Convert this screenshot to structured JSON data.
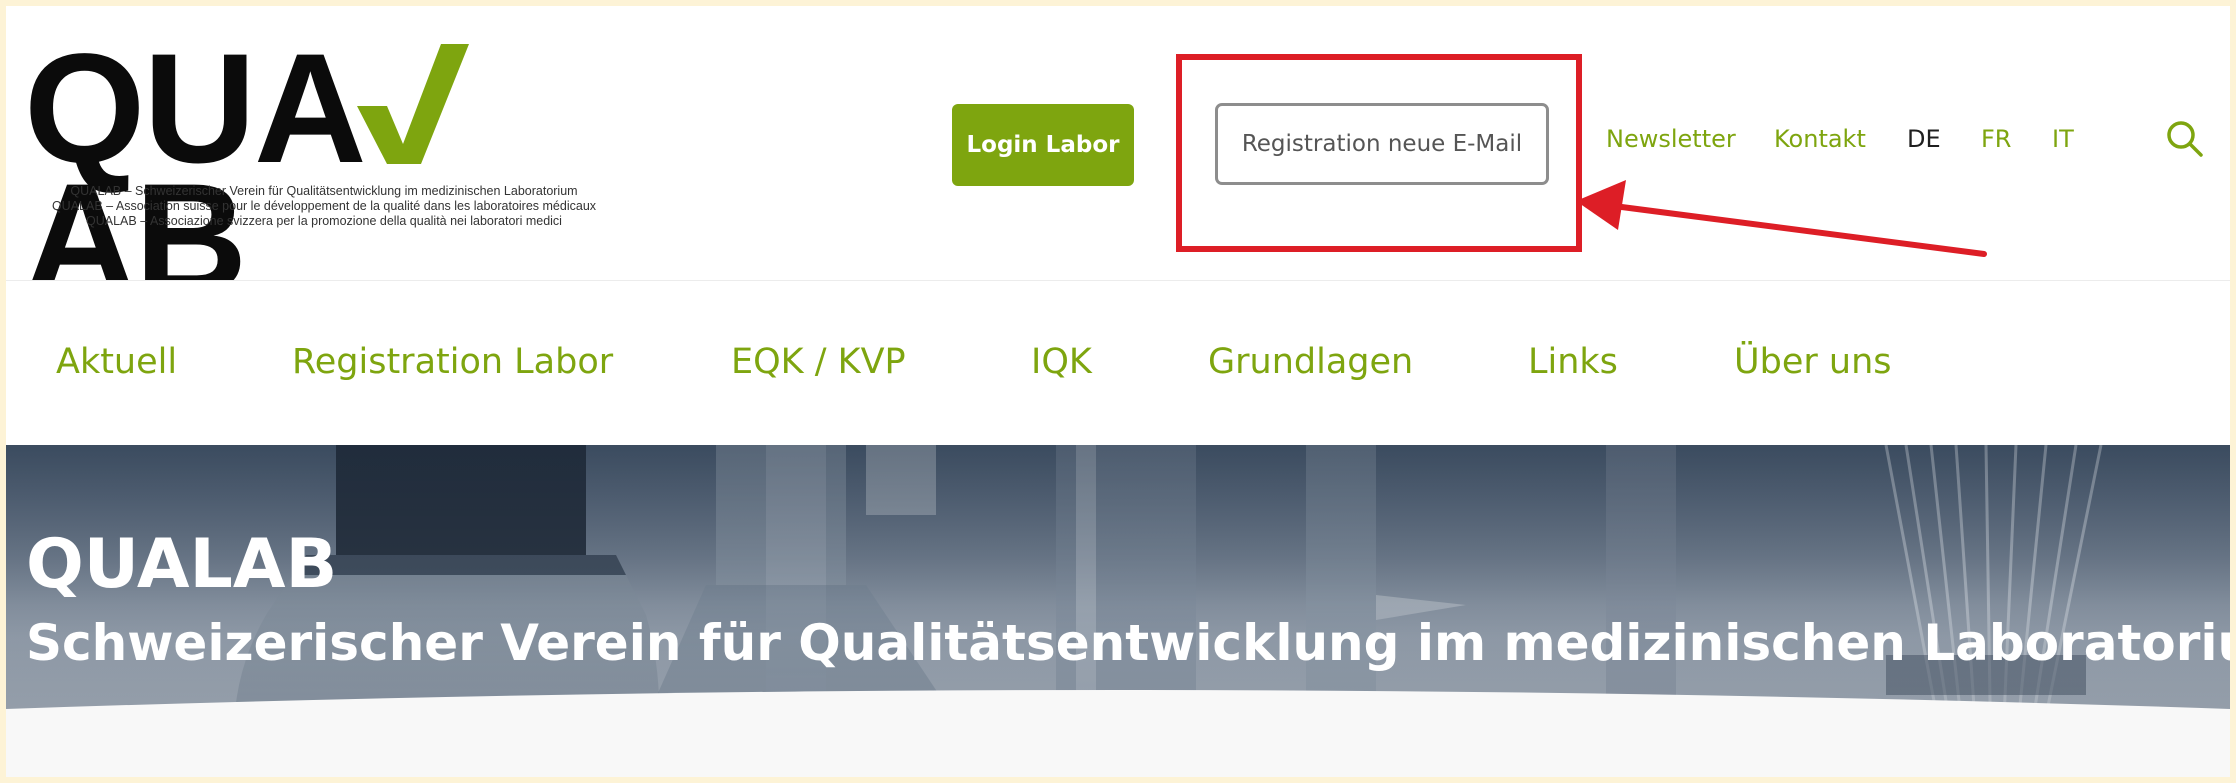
{
  "logo": {
    "letters_left": "QUA",
    "letters_right": "AB",
    "tagline": [
      "QUALAB – Schweizerischer Verein für Qualitätsentwicklung im medizinischen Laboratorium",
      "QUALAB – Association suisse pour le développement de la qualité dans les laboratoires médicaux",
      "QUALAB – Associazione svizzera per la promozione della qualità nei laboratori medici"
    ]
  },
  "header": {
    "login_label": "Login Labor",
    "registration_email_label": "Registration neue E-Mail",
    "links": {
      "newsletter": "Newsletter",
      "kontakt": "Kontakt"
    },
    "languages": {
      "de": "DE",
      "fr": "FR",
      "it": "IT"
    },
    "active_language": "DE"
  },
  "nav": {
    "items": [
      "Aktuell",
      "Registration Labor",
      "EQK / KVP",
      "IQK",
      "Grundlagen",
      "Links",
      "Über uns"
    ]
  },
  "hero": {
    "title": "QUALAB",
    "subtitle": "Schweizerischer Verein für Qualitätsentwicklung im medizinischen Laboratorium"
  },
  "colors": {
    "brand_green": "#7ea50f",
    "annotation_red": "#dd1e26",
    "page_frame": "#fdf3d6"
  },
  "icons": [
    "search-icon",
    "check-icon"
  ]
}
